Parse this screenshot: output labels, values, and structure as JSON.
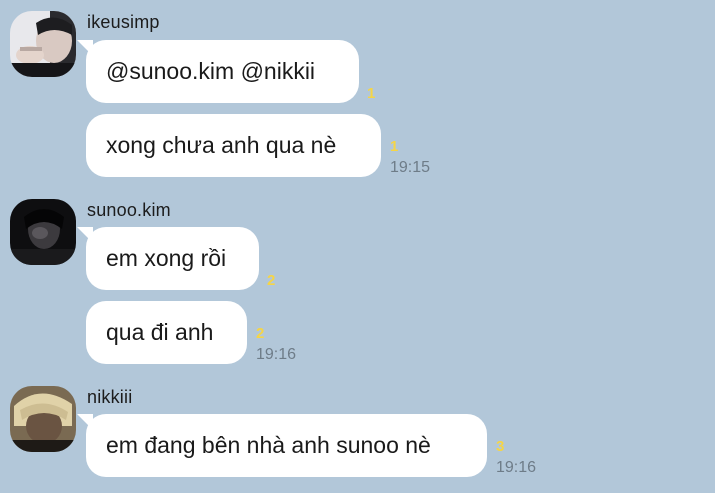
{
  "groups": [
    {
      "sender": "ikeusimp",
      "avatar_icon": "profile-photo-ikeusimp",
      "messages": [
        {
          "text": "@sunoo.kim @nikkii",
          "unread": "1",
          "time": ""
        },
        {
          "text": "xong chưa anh qua nè",
          "unread": "1",
          "time": "19:15"
        }
      ]
    },
    {
      "sender": "sunoo.kim",
      "avatar_icon": "profile-photo-sunoo",
      "messages": [
        {
          "text": "em xong rồi",
          "unread": "2",
          "time": ""
        },
        {
          "text": "qua đi anh",
          "unread": "2",
          "time": "19:16"
        }
      ]
    },
    {
      "sender": "nikkiii",
      "avatar_icon": "profile-photo-nikkiii",
      "messages": [
        {
          "text": "em đang bên nhà anh sunoo nè",
          "unread": "3",
          "time": "19:16"
        }
      ]
    }
  ],
  "colors": {
    "background": "#b2c7d9",
    "bubble": "#ffffff",
    "unread_count": "#f5d547",
    "time": "#6e7c88"
  }
}
